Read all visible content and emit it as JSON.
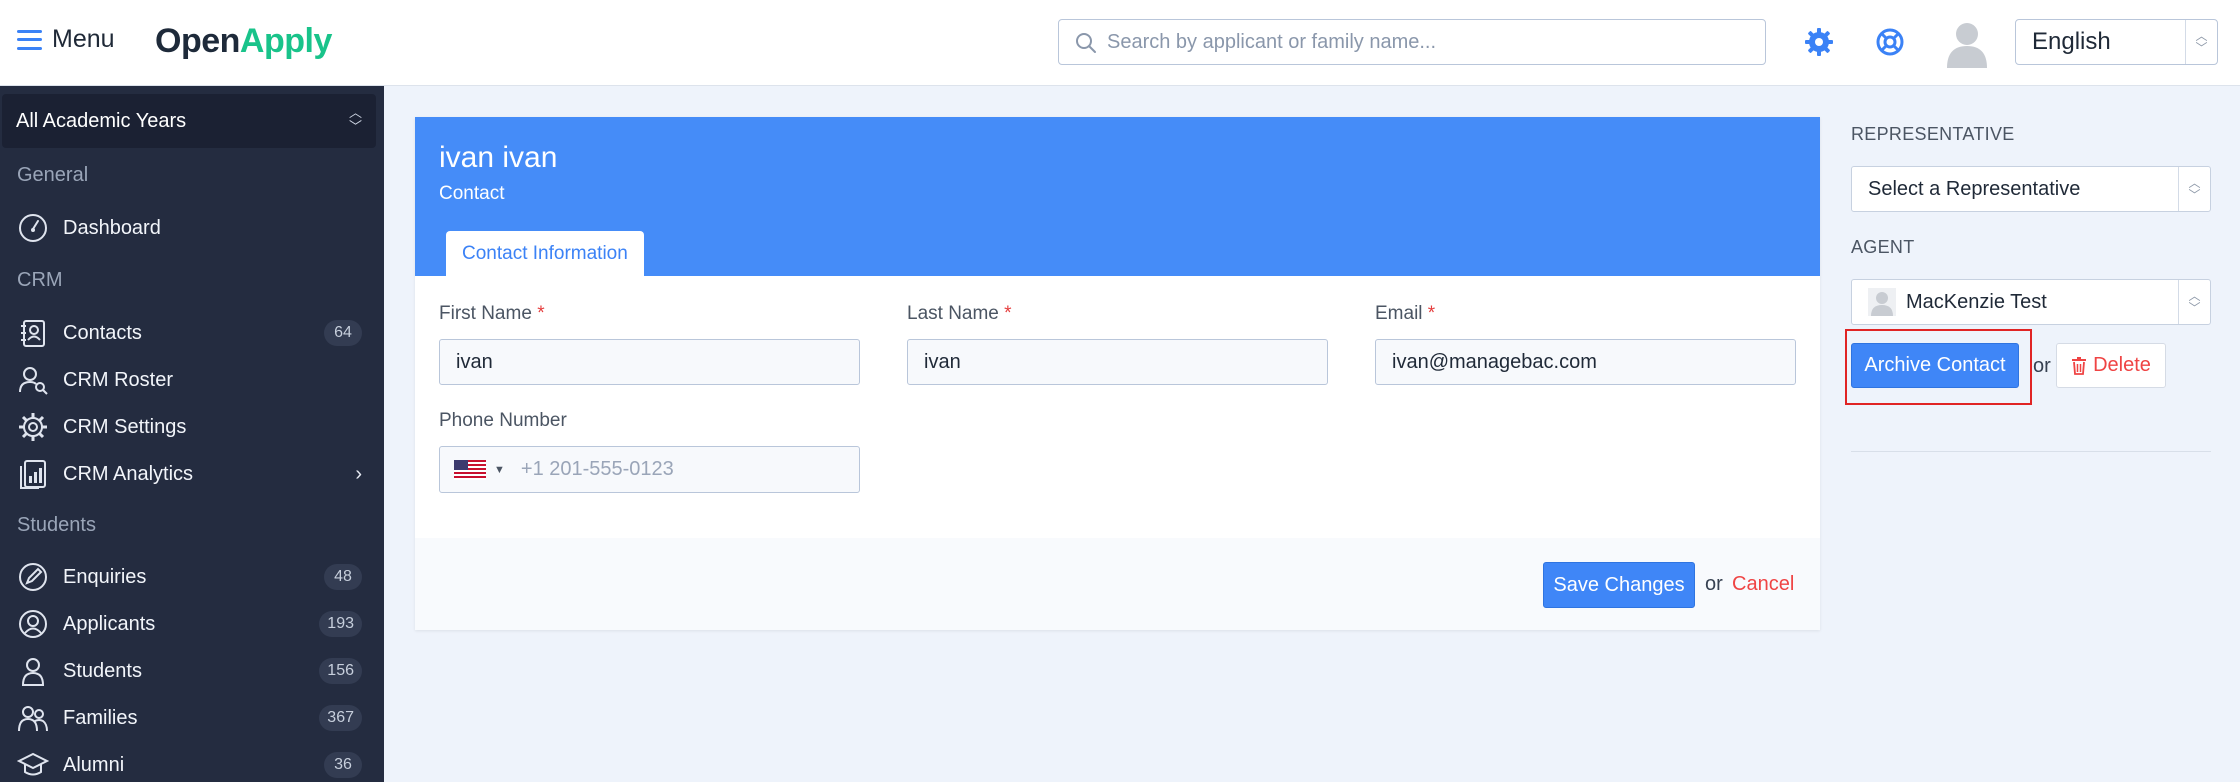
{
  "header": {
    "menu_label": "Menu",
    "logo_part1": "Open",
    "logo_part2": "Apply",
    "search_placeholder": "Search by applicant or family name...",
    "language": "English"
  },
  "sidebar": {
    "year_selector": "All Academic Years",
    "sections": {
      "general": "General",
      "crm": "CRM",
      "students": "Students"
    },
    "items": [
      {
        "label": "Dashboard",
        "icon": "dashboard-icon"
      },
      {
        "label": "Contacts",
        "count": "64",
        "icon": "contacts-icon"
      },
      {
        "label": "CRM Roster",
        "icon": "roster-icon"
      },
      {
        "label": "CRM Settings",
        "icon": "settings-gear-icon"
      },
      {
        "label": "CRM Analytics",
        "icon": "analytics-icon",
        "has_submenu": true
      },
      {
        "label": "Enquiries",
        "count": "48",
        "icon": "enquiries-icon"
      },
      {
        "label": "Applicants",
        "count": "193",
        "icon": "applicants-icon"
      },
      {
        "label": "Students",
        "count": "156",
        "icon": "students-icon"
      },
      {
        "label": "Families",
        "count": "367",
        "icon": "families-icon"
      },
      {
        "label": "Alumni",
        "count": "36",
        "icon": "alumni-icon"
      }
    ]
  },
  "contact": {
    "name": "ivan ivan",
    "type": "Contact",
    "tab": "Contact Information",
    "fields": {
      "first_name_label": "First Name",
      "first_name": "ivan",
      "last_name_label": "Last Name",
      "last_name": "ivan",
      "email_label": "Email",
      "email": "ivan@managebac.com",
      "phone_label": "Phone Number",
      "phone_placeholder": "+1 201-555-0123",
      "required_mark": "*"
    },
    "save_label": "Save Changes",
    "or_label": "or",
    "cancel_label": "Cancel"
  },
  "side_panel": {
    "representative_label": "REPRESENTATIVE",
    "representative_value": "Select a Representative",
    "agent_label": "AGENT",
    "agent_value": "MacKenzie Test",
    "archive_label": "Archive Contact",
    "or_label": "or",
    "delete_label": "Delete"
  },
  "colors": {
    "accent": "#458cf8",
    "sidebar_bg": "#242c40",
    "logo_green": "#19c38a",
    "danger": "#ef4444",
    "highlight": "#e02424"
  }
}
